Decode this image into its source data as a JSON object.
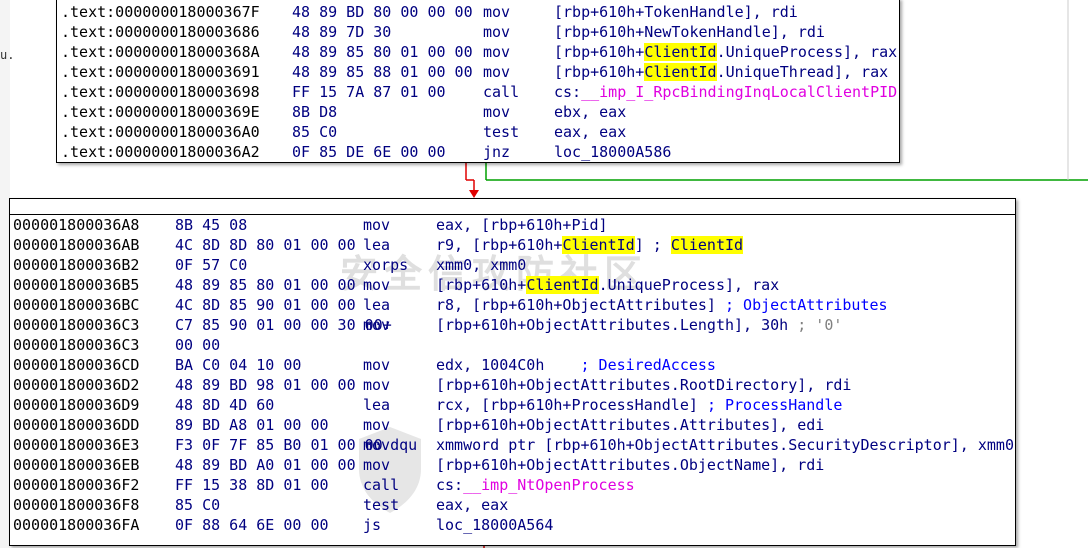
{
  "side_labels": [
    "",
    "u.",
    "",
    "",
    "",
    ""
  ],
  "block1": {
    "rows": [
      {
        "addr": ".text:000000018000367F",
        "bytes": "48 89 BD 80 00 00 00",
        "mnemonic": "mov",
        "operand": [
          {
            "t": "[rbp+610h+TokenHandle], rdi"
          }
        ]
      },
      {
        "addr": ".text:0000000180003686",
        "bytes": "48 89 7D 30",
        "mnemonic": "mov",
        "operand": [
          {
            "t": "[rbp+610h+NewTokenHandle], rdi"
          }
        ]
      },
      {
        "addr": ".text:000000018000368A",
        "bytes": "48 89 85 80 01 00 00",
        "mnemonic": "mov",
        "operand": [
          {
            "t": "[rbp+610h+"
          },
          {
            "t": "ClientId",
            "s": "hl"
          },
          {
            "t": ".UniqueProcess], rax"
          }
        ]
      },
      {
        "addr": ".text:0000000180003691",
        "bytes": "48 89 85 88 01 00 00",
        "mnemonic": "mov",
        "operand": [
          {
            "t": "[rbp+610h+"
          },
          {
            "t": "ClientId",
            "s": "hl"
          },
          {
            "t": ".UniqueThread], rax"
          }
        ]
      },
      {
        "addr": ".text:0000000180003698",
        "bytes": "FF 15 7A 87 01 00",
        "mnemonic": "call",
        "operand": [
          {
            "t": "cs:"
          },
          {
            "t": "__imp_I_RpcBindingInqLocalClientPID",
            "s": "mg"
          }
        ]
      },
      {
        "addr": ".text:000000018000369E",
        "bytes": "8B D8",
        "mnemonic": "mov",
        "operand": [
          {
            "t": "ebx, eax"
          }
        ]
      },
      {
        "addr": ".text:00000001800036A0",
        "bytes": "85 C0",
        "mnemonic": "test",
        "operand": [
          {
            "t": "eax, eax"
          }
        ]
      },
      {
        "addr": ".text:00000001800036A2",
        "bytes": "0F 85 DE 6E 00 00",
        "mnemonic": "jnz",
        "operand": [
          {
            "t": "loc_18000A586"
          }
        ]
      }
    ]
  },
  "block2": {
    "rows": [
      {
        "addr": "000001800036A8",
        "bytes": "8B 45 08",
        "mnemonic": "mov",
        "operand": [
          {
            "t": "eax, [rbp+610h+Pid]"
          }
        ]
      },
      {
        "addr": "000001800036AB",
        "bytes": "4C 8D 8D 80 01 00 00",
        "mnemonic": "lea",
        "operand": [
          {
            "t": "r9, [rbp+610h+"
          },
          {
            "t": "ClientId",
            "s": "hl"
          },
          {
            "t": "] ; "
          },
          {
            "t": "ClientId",
            "s": "hl"
          }
        ]
      },
      {
        "addr": "000001800036B2",
        "bytes": "0F 57 C0",
        "mnemonic": "xorps",
        "operand": [
          {
            "t": "xmm0, xmm0"
          }
        ]
      },
      {
        "addr": "000001800036B5",
        "bytes": "48 89 85 80 01 00 00",
        "mnemonic": "mov",
        "operand": [
          {
            "t": "[rbp+610h+"
          },
          {
            "t": "ClientId",
            "s": "hl"
          },
          {
            "t": ".UniqueProcess], rax"
          }
        ]
      },
      {
        "addr": "000001800036BC",
        "bytes": "4C 8D 85 90 01 00 00",
        "mnemonic": "lea",
        "operand": [
          {
            "t": "r8, [rbp+610h+ObjectAttributes] "
          },
          {
            "t": "; ObjectAttributes",
            "s": "cm"
          }
        ]
      },
      {
        "addr": "000001800036C3",
        "bytes": "C7 85 90 01 00 00 30 00+",
        "mnemonic": "mov",
        "operand": [
          {
            "t": "[rbp+610h+ObjectAttributes.Length], 30h "
          },
          {
            "t": "; '0'",
            "s": "gr"
          }
        ]
      },
      {
        "addr": "000001800036C3",
        "bytes": "00 00",
        "mnemonic": "",
        "operand": []
      },
      {
        "addr": "000001800036CD",
        "bytes": "BA C0 04 10 00",
        "mnemonic": "mov",
        "operand": [
          {
            "t": "edx, 1004C0h    "
          },
          {
            "t": "; DesiredAccess",
            "s": "cm"
          }
        ]
      },
      {
        "addr": "000001800036D2",
        "bytes": "48 89 BD 98 01 00 00",
        "mnemonic": "mov",
        "operand": [
          {
            "t": "[rbp+610h+ObjectAttributes.RootDirectory], rdi"
          }
        ]
      },
      {
        "addr": "000001800036D9",
        "bytes": "48 8D 4D 60",
        "mnemonic": "lea",
        "operand": [
          {
            "t": "rcx, [rbp+610h+ProcessHandle] "
          },
          {
            "t": "; ProcessHandle",
            "s": "cm"
          }
        ]
      },
      {
        "addr": "000001800036DD",
        "bytes": "89 BD A8 01 00 00",
        "mnemonic": "mov",
        "operand": [
          {
            "t": "[rbp+610h+ObjectAttributes.Attributes], edi"
          }
        ]
      },
      {
        "addr": "000001800036E3",
        "bytes": "F3 0F 7F 85 B0 01 00 00",
        "mnemonic": "movdqu",
        "operand": [
          {
            "t": "xmmword ptr [rbp+610h+ObjectAttributes.SecurityDescriptor], xmm0"
          }
        ]
      },
      {
        "addr": "000001800036EB",
        "bytes": "48 89 BD A0 01 00 00",
        "mnemonic": "mov",
        "operand": [
          {
            "t": "[rbp+610h+ObjectAttributes.ObjectName], rdi"
          }
        ]
      },
      {
        "addr": "000001800036F2",
        "bytes": "FF 15 38 8D 01 00",
        "mnemonic": "call",
        "operand": [
          {
            "t": "cs:"
          },
          {
            "t": "__imp_NtOpenProcess",
            "s": "mg"
          }
        ]
      },
      {
        "addr": "000001800036F8",
        "bytes": "85 C0",
        "mnemonic": "test",
        "operand": [
          {
            "t": "eax, eax"
          }
        ]
      },
      {
        "addr": "000001800036FA",
        "bytes": "0F 88 64 6E 00 00",
        "mnemonic": "js",
        "operand": [
          {
            "t": "loc_18000A564"
          }
        ]
      }
    ]
  },
  "watermark": "安全信攻防社区",
  "colors": {
    "edge_true": "#00a000",
    "edge_false": "#e00000",
    "highlight": "#ffff00",
    "import": "#e000e0",
    "comment": "#0000ff"
  }
}
